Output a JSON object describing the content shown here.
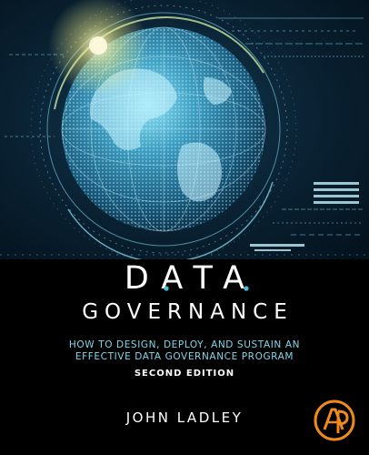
{
  "book": {
    "title_word1": "DATA",
    "title_word2": "GOVERNANCE",
    "subtitle_line1": "How to Design, Deploy, and Sustain an",
    "subtitle_line2": "Effective Data Governance Program",
    "edition": "SECOND EDITION",
    "author": "JOHN LADLEY"
  },
  "colors": {
    "background": "#000000",
    "subtitle": "#7fd7ea",
    "accent_dot": "#3fc3e4",
    "globe": "#4ab0d0",
    "logo": "#f08a1c"
  },
  "icons": {
    "publisher_logo": "publisher-logo-icon",
    "globe": "globe-artwork"
  }
}
